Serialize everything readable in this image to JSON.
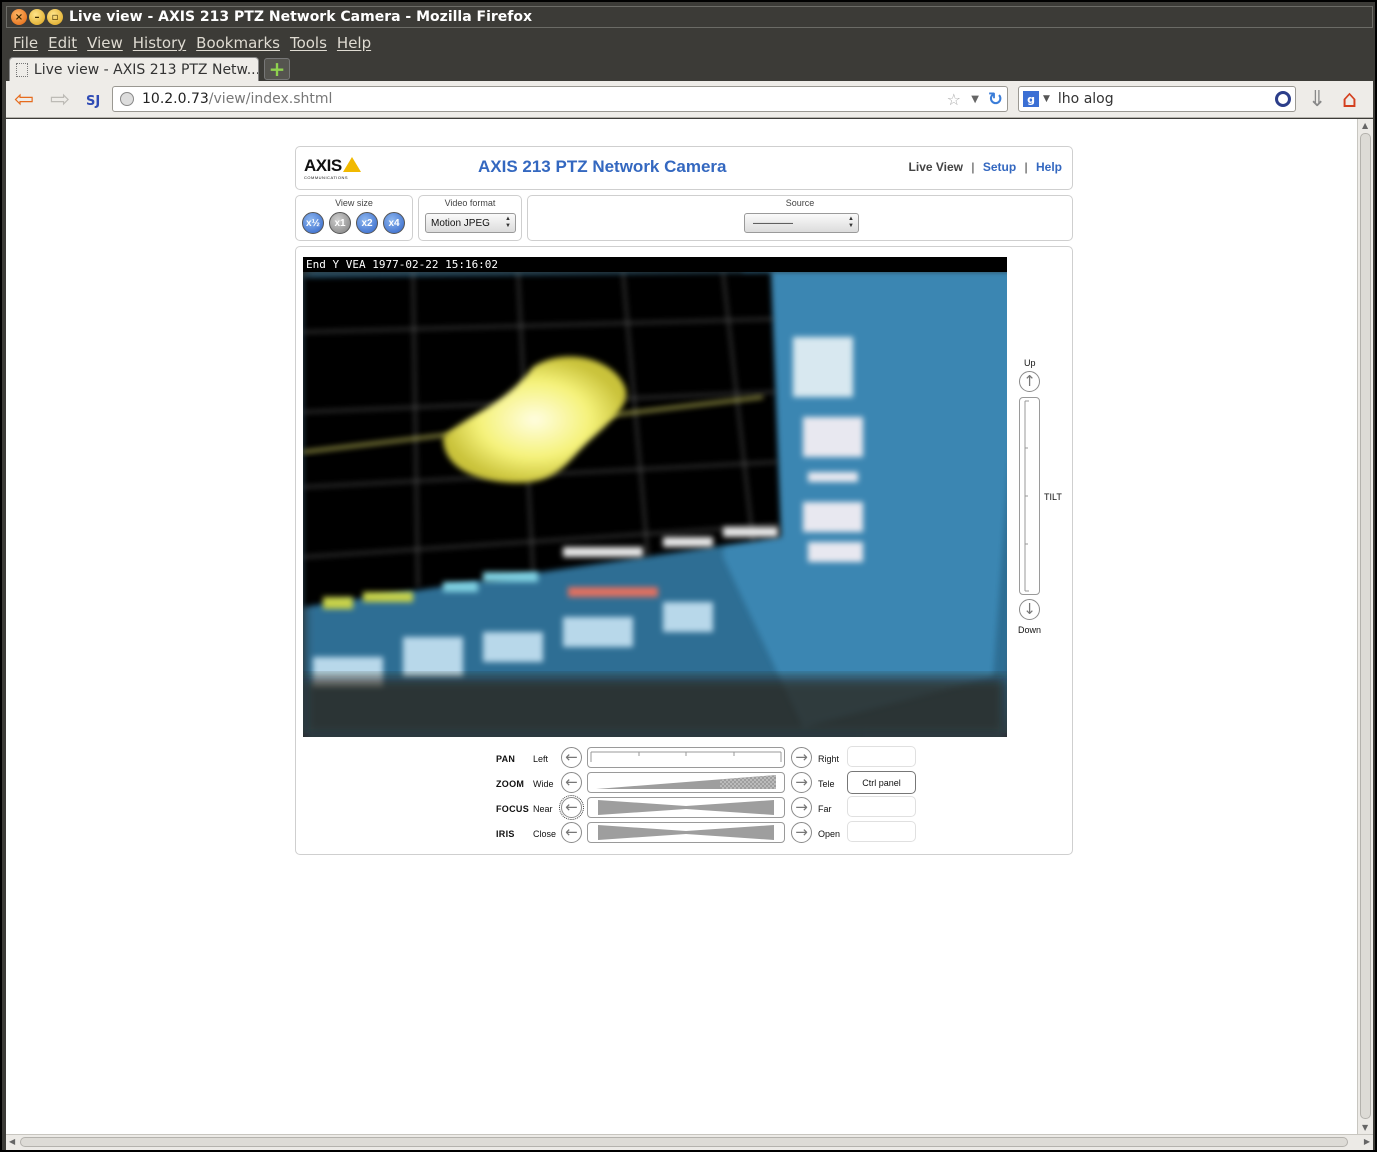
{
  "window": {
    "title": "Live view - AXIS 213 PTZ Network Camera - Mozilla Firefox"
  },
  "menu": {
    "items": [
      "File",
      "Edit",
      "View",
      "History",
      "Bookmarks",
      "Tools",
      "Help"
    ]
  },
  "tab": {
    "title": "Live view - AXIS 213 PTZ Netw..."
  },
  "url": {
    "host": "10.2.0.73",
    "path": "/view/index.shtml"
  },
  "search": {
    "engine_icon": "g",
    "query": "lho alog"
  },
  "page": {
    "logo": "AXIS",
    "logo_sub": "COMMUNICATIONS",
    "title": "AXIS 213 PTZ Network Camera",
    "nav": {
      "live_view": "Live View",
      "setup": "Setup",
      "help": "Help",
      "separator": "|"
    },
    "view_size": {
      "label": "View size",
      "buttons": [
        "x½",
        "x1",
        "x2",
        "x4"
      ]
    },
    "video_format": {
      "label": "Video format",
      "value": "Motion JPEG"
    },
    "source": {
      "label": "Source",
      "value": "————"
    },
    "video": {
      "osd_text": "End Y VEA 1977-02-22 15:16:02"
    },
    "tilt": {
      "up": "Up",
      "down": "Down",
      "label": "TILT"
    },
    "controls": [
      {
        "name": "PAN",
        "left": "Left",
        "right": "Right"
      },
      {
        "name": "ZOOM",
        "left": "Wide",
        "right": "Tele"
      },
      {
        "name": "FOCUS",
        "left": "Near",
        "right": "Far"
      },
      {
        "name": "IRIS",
        "left": "Close",
        "right": "Open"
      }
    ],
    "ctrl_panel": "Ctrl panel"
  },
  "colors": {
    "link_blue": "#3468c0",
    "axis_yellow": "#f1b900",
    "chrome_dark": "#3c3b37"
  }
}
